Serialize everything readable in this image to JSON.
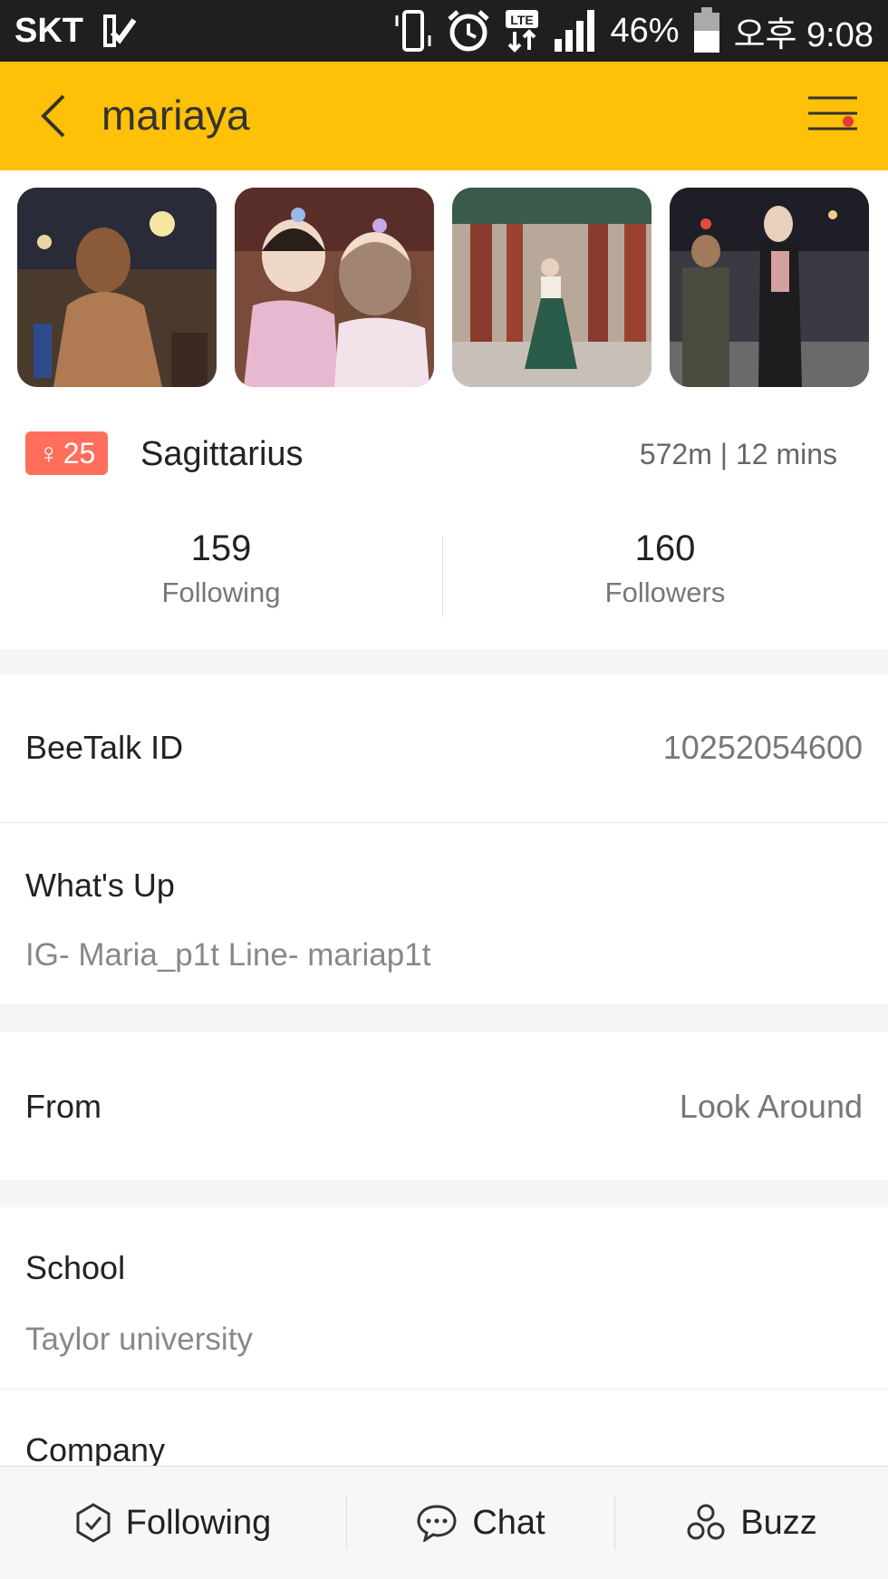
{
  "status_bar": {
    "carrier": "SKT",
    "network": "LTE",
    "battery": "46%",
    "time": "오후 9:08",
    "icons": [
      "vibrate-icon",
      "alarm-icon",
      "lte-icon",
      "signal-icon",
      "battery-icon"
    ]
  },
  "header": {
    "title": "mariaya",
    "back_icon": "chevron-left-icon",
    "menu_icon": "menu-icon",
    "colors": {
      "background": "#FFC107",
      "notification_dot": "#E53935"
    }
  },
  "photos": {
    "count": 4
  },
  "profile": {
    "gender_symbol": "♀",
    "age": "25",
    "zodiac": "Sagittarius",
    "distance_time": "572m | 12 mins",
    "badge_color": "#FF6E5A"
  },
  "stats": {
    "following_count": "159",
    "following_label": "Following",
    "followers_count": "160",
    "followers_label": "Followers"
  },
  "details": {
    "beetalk_id_label": "BeeTalk ID",
    "beetalk_id_value": "10252054600",
    "whats_up_label": "What's Up",
    "whats_up_value": "IG- Maria_p1t  Line- mariap1t",
    "from_label": "From",
    "from_value": "Look Around",
    "school_label": "School",
    "school_value": "Taylor university",
    "company_label": "Company"
  },
  "bottom_bar": {
    "following_label": "Following",
    "chat_label": "Chat",
    "buzz_label": "Buzz"
  }
}
